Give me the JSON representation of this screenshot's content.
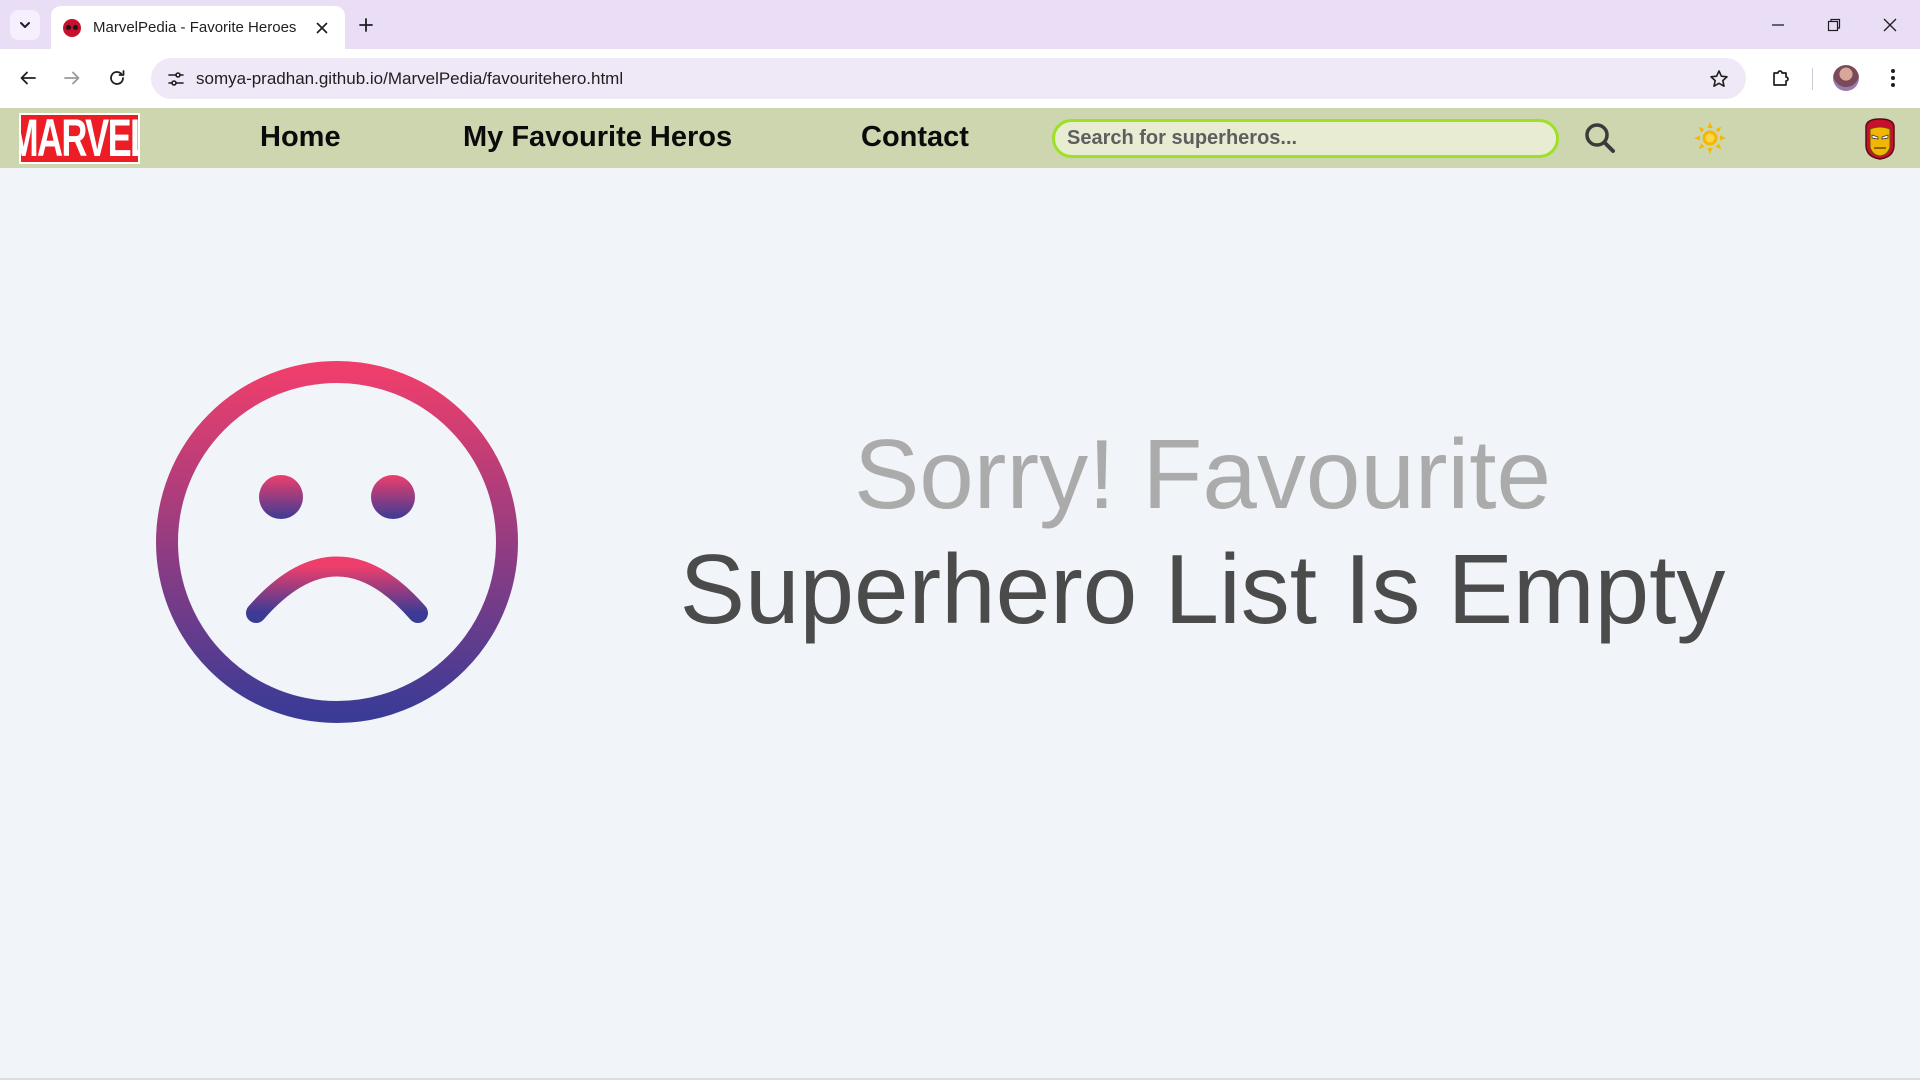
{
  "browser": {
    "tab_title": "MarvelPedia - Favorite Heroes",
    "url": "somya-pradhan.github.io/MarvelPedia/favouritehero.html"
  },
  "navbar": {
    "logo_text": "MARVEL",
    "links": [
      {
        "label": "Home"
      },
      {
        "label": "My Favourite Heros"
      },
      {
        "label": "Contact"
      }
    ],
    "search_placeholder": "Search for superheros..."
  },
  "main": {
    "message_line1": "Sorry! Favourite",
    "message_line2": "Superhero List Is Empty"
  },
  "icons": {
    "tab_search": "chevron-down-icon",
    "tab_close": "close-icon",
    "new_tab": "plus-icon",
    "back": "arrow-left-icon",
    "forward": "arrow-right-icon",
    "reload": "reload-icon",
    "site_info": "tune-icon",
    "bookmark": "star-icon",
    "extensions": "puzzle-icon",
    "menu": "kebab-menu-icon",
    "search": "search-icon",
    "theme": "sun-icon",
    "profile": "iron-man-avatar-icon",
    "empty_state": "sad-face-icon"
  },
  "colors": {
    "tabstrip": "#e9def5",
    "navbar": "#cdd6ae",
    "search_border": "#9ee023",
    "logo_red": "#ec1d24",
    "sun": "#f5b800",
    "face_gradient_top": "#ee3e6c",
    "face_gradient_bottom": "#3b3b96",
    "page_bg": "#f1f4f9"
  }
}
